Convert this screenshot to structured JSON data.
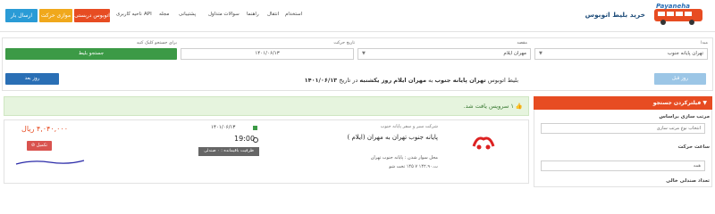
{
  "header": {
    "logo_text": "Payaneha",
    "site_title": "خرید بلیط اتوبوس",
    "buttons": [
      {
        "label": "ارسال بار",
        "color": "#2a9bd6"
      },
      {
        "label": "موازی حرکت",
        "color": "#f0a81c"
      },
      {
        "label": "اتوبوس دربستی",
        "color": "#e74c22"
      }
    ],
    "nav_links": [
      "ناحیه کاربری",
      "API",
      "مجله",
      "پشتیبانی",
      "سوالات متداول",
      "راهنما",
      "انتقال",
      "استخدام"
    ]
  },
  "search": {
    "origin_label": "مبدا",
    "origin_value": "تهران پایانه جنوب",
    "destination_label": "مقصد",
    "destination_value": "مهران ایلام",
    "date_label": "تاریخ حرکت",
    "date_value": "۱۴۰۱/۰۶/۱۳",
    "search_hint": "برای جستجو کلیک کنید",
    "search_button": "جستجو بلیط",
    "prev_day_button": "روز قبل",
    "next_day_button": "روز بعد",
    "route_prefix": "بلیط اتوبوس",
    "route_origin": "تهران پایانه جنوب",
    "route_to": "به",
    "route_destination": "مهران ایلام",
    "route_day": "روز یکشنبه",
    "route_date_prefix": "در تاریخ",
    "route_date": "۱۴۰۱/۰۶/۱۳"
  },
  "filters": {
    "title": "فیلترکردن جستجو",
    "sort_label": "مرتب سازی براساس",
    "sort_placeholder": "انتخاب نوع مرتب سازی",
    "time_label": "ساعت حرکت",
    "time_value": "همه",
    "seats_label": "تعداد صندلی خالی"
  },
  "results": {
    "found_text": "۱ سرویس یافت شد.",
    "company": "شرکت سیر و سفر پایانه جنوب",
    "route": "پایانه جنوب تهران به مهران (ایلام )",
    "boarding_label": "محل سوار شدن : پایانه جنوب تهران",
    "bus_info": "ت.۱۴۲.۹۰ ۷ ۱۴۵ تخت شو",
    "date": "۱۴۰۱/۰۶/۱۳",
    "time": "19:00",
    "capacity": "ظرفیت باقیمانده : ۰ صندلی",
    "price": "۴,۰۴۰,۰۰۰ ریال",
    "full_badge": "تکمیل"
  },
  "colors": {
    "accent_orange": "#e74c22",
    "green": "#3c9a46",
    "blue": "#2a9bd6"
  }
}
